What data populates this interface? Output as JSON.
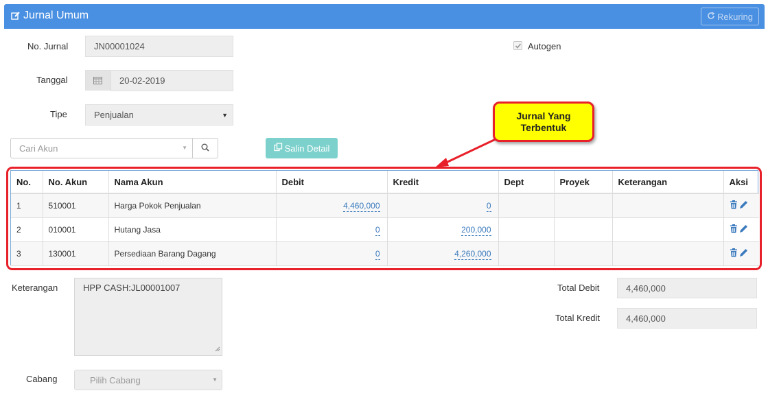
{
  "header": {
    "title": "Jurnal Umum",
    "rekuring_label": "Rekuring"
  },
  "form": {
    "no_jurnal_label": "No. Jurnal",
    "no_jurnal_value": "JN00001024",
    "tanggal_label": "Tanggal",
    "tanggal_value": "20-02-2019",
    "tipe_label": "Tipe",
    "tipe_value": "Penjualan",
    "autogen_label": "Autogen",
    "autogen_checked": true,
    "cari_akun_placeholder": "Cari Akun",
    "salin_detail_label": "Salin Detail"
  },
  "callout": {
    "text": "Jurnal Yang\nTerbentuk"
  },
  "table": {
    "headers": [
      "No.",
      "No. Akun",
      "Nama Akun",
      "Debit",
      "Kredit",
      "Dept",
      "Proyek",
      "Keterangan",
      "Aksi"
    ],
    "rows": [
      {
        "no": "1",
        "no_akun": "510001",
        "nama_akun": "Harga Pokok Penjualan",
        "debit": "4,460,000",
        "kredit": "0",
        "dept": "",
        "proyek": "",
        "keterangan": ""
      },
      {
        "no": "2",
        "no_akun": "010001",
        "nama_akun": "Hutang Jasa",
        "debit": "0",
        "kredit": "200,000",
        "dept": "",
        "proyek": "",
        "keterangan": ""
      },
      {
        "no": "3",
        "no_akun": "130001",
        "nama_akun": "Persediaan Barang Dagang",
        "debit": "0",
        "kredit": "4,260,000",
        "dept": "",
        "proyek": "",
        "keterangan": ""
      }
    ]
  },
  "footer": {
    "keterangan_label": "Keterangan",
    "keterangan_value": "HPP CASH:JL00001007",
    "total_debit_label": "Total Debit",
    "total_debit_value": "4,460,000",
    "total_kredit_label": "Total Kredit",
    "total_kredit_value": "4,460,000",
    "cabang_label": "Cabang",
    "cabang_placeholder": "Pilih Cabang"
  },
  "colors": {
    "header_bg": "#4a90e2",
    "accent_teal": "#7dd1cc",
    "annotation_red": "#e8202a",
    "annotation_yellow": "#ffff00",
    "link_blue": "#3a7abd"
  },
  "icons": {
    "title": "edit-icon",
    "rekuring": "refresh-icon",
    "date": "calendar-icon",
    "search": "search-icon",
    "salin": "copy-icon",
    "delete": "trash-icon",
    "edit_row": "pencil-icon"
  }
}
